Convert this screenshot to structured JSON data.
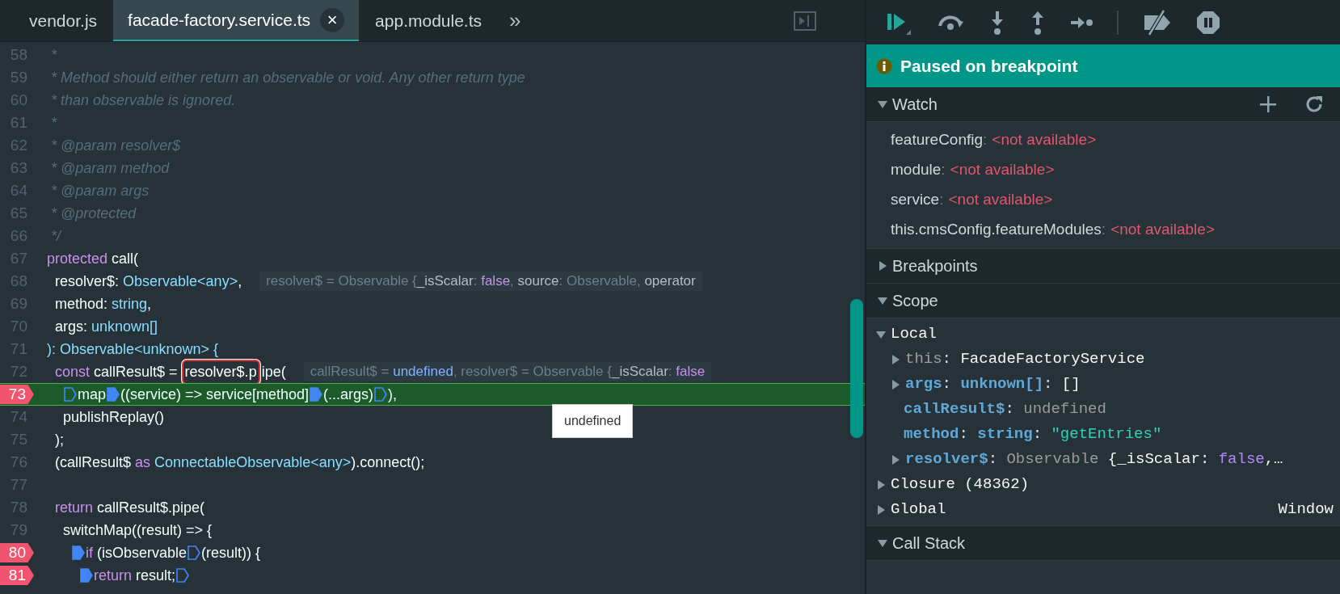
{
  "tabs": [
    {
      "label": "vendor.js",
      "selected": false
    },
    {
      "label": "facade-factory.service.ts",
      "selected": true,
      "close": "×"
    },
    {
      "label": "app.module.ts",
      "selected": false
    }
  ],
  "tabs_overflow": "»",
  "editor": {
    "lines": [
      {
        "number": "58",
        "breakpoint": false,
        "current": false,
        "tokens": [
          {
            "text": " *",
            "kind": "comment"
          }
        ]
      },
      {
        "number": "59",
        "breakpoint": false,
        "current": false,
        "tokens": [
          {
            "text": " * Method should either return an observable or void. Any other return type",
            "kind": "comment"
          }
        ]
      },
      {
        "number": "60",
        "breakpoint": false,
        "current": false,
        "tokens": [
          {
            "text": " * than observable is ignored.",
            "kind": "comment"
          }
        ]
      },
      {
        "number": "61",
        "breakpoint": false,
        "current": false,
        "tokens": [
          {
            "text": " *",
            "kind": "comment"
          }
        ]
      },
      {
        "number": "62",
        "breakpoint": false,
        "current": false,
        "tokens": [
          {
            "text": " * @param resolver$",
            "kind": "comment"
          }
        ]
      },
      {
        "number": "63",
        "breakpoint": false,
        "current": false,
        "tokens": [
          {
            "text": " * @param method",
            "kind": "comment"
          }
        ]
      },
      {
        "number": "64",
        "breakpoint": false,
        "current": false,
        "tokens": [
          {
            "text": " * @param args",
            "kind": "comment"
          }
        ]
      },
      {
        "number": "65",
        "breakpoint": false,
        "current": false,
        "tokens": [
          {
            "text": " * @protected",
            "kind": "comment"
          }
        ]
      },
      {
        "number": "66",
        "breakpoint": false,
        "current": false,
        "tokens": [
          {
            "text": " */",
            "kind": "comment"
          }
        ]
      },
      {
        "number": "67",
        "breakpoint": false,
        "current": false,
        "tokens": [
          {
            "text": "protected",
            "kind": "keyword"
          },
          {
            "text": " call(",
            "kind": "plain"
          }
        ],
        "children": [
          {
            "number": "68",
            "breakpoint": false,
            "current": false,
            "tokens": [
              {
                "text": "resolver$: ",
                "kind": "plain"
              },
              {
                "text": "Observable<any>",
                "kind": "type"
              },
              {
                "text": ",",
                "kind": "plain"
              }
            ],
            "hint": [
              {
                "text": "resolver$ = Observable {",
                "kind": "dim"
              },
              {
                "text": "_isScalar",
                "kind": "key"
              },
              {
                "text": ": ",
                "kind": "dim"
              },
              {
                "text": "false",
                "kind": "bool"
              },
              {
                "text": ", ",
                "kind": "dim"
              },
              {
                "text": "source",
                "kind": "key"
              },
              {
                "text": ": Observable, ",
                "kind": "dim"
              },
              {
                "text": "operator",
                "kind": "key"
              }
            ]
          },
          {
            "number": "69",
            "breakpoint": false,
            "current": false,
            "tokens": [
              {
                "text": "method: ",
                "kind": "plain"
              },
              {
                "text": "string",
                "kind": "type"
              },
              {
                "text": ",",
                "kind": "plain"
              }
            ]
          },
          {
            "number": "70",
            "breakpoint": false,
            "current": false,
            "tokens": [
              {
                "text": "args: ",
                "kind": "plain"
              },
              {
                "text": "unknown[]",
                "kind": "type"
              }
            ]
          }
        ]
      },
      {
        "number": "71",
        "breakpoint": false,
        "current": false,
        "tokens": [
          {
            "text": "): Observable<unknown> {",
            "kind": "type"
          }
        ],
        "children": [
          {
            "number": "72",
            "breakpoint": false,
            "current": false,
            "tokens": [
              {
                "text": "const",
                "kind": "keyword"
              },
              {
                "text": " callResult$ = ",
                "kind": "plain"
              },
              {
                "text": "resolver$.p",
                "kind": "hovered"
              },
              {
                "text": "ipe(",
                "kind": "plain"
              }
            ],
            "hint": [
              {
                "text": "callResult$ = ",
                "kind": "dim"
              },
              {
                "text": "undefined",
                "kind": "undef"
              },
              {
                "text": ", resolver$ = Observable {",
                "kind": "dim"
              },
              {
                "text": "_isScalar",
                "kind": "key"
              },
              {
                "text": ": ",
                "kind": "dim"
              },
              {
                "text": "false",
                "kind": "bool"
              }
            ],
            "children": [
              {
                "number": "73",
                "breakpoint": true,
                "current": true,
                "tokens": [
                  {
                    "kind": "marker",
                    "active": false
                  },
                  {
                    "text": "map",
                    "kind": "plain"
                  },
                  {
                    "kind": "marker",
                    "active": true
                  },
                  {
                    "text": "((service) => service[method]",
                    "kind": "plain"
                  },
                  {
                    "kind": "marker",
                    "active": true
                  },
                  {
                    "text": "(...args)",
                    "kind": "plain"
                  },
                  {
                    "kind": "marker",
                    "active": false
                  },
                  {
                    "text": "),",
                    "kind": "plain"
                  }
                ]
              },
              {
                "number": "74",
                "breakpoint": false,
                "current": false,
                "tokens": [
                  {
                    "text": "publishReplay()",
                    "kind": "plain"
                  }
                ]
              }
            ]
          },
          {
            "number": "75",
            "breakpoint": false,
            "current": false,
            "tokens": [
              {
                "text": ");",
                "kind": "plain"
              }
            ]
          },
          {
            "number": "76",
            "breakpoint": false,
            "current": false,
            "tokens": [
              {
                "text": "(callResult$ ",
                "kind": "plain"
              },
              {
                "text": "as",
                "kind": "keyword"
              },
              {
                "text": " ConnectableObservable<any>",
                "kind": "type"
              },
              {
                "text": ").connect();",
                "kind": "plain"
              }
            ]
          },
          {
            "number": "77",
            "breakpoint": false,
            "current": false
          },
          {
            "number": "78",
            "breakpoint": false,
            "current": false,
            "tokens": [
              {
                "text": "return",
                "kind": "keyword"
              },
              {
                "text": " callResult$.pipe(",
                "kind": "plain"
              }
            ],
            "children": [
              {
                "number": "79",
                "breakpoint": false,
                "current": false,
                "tokens": [
                  {
                    "text": "switchMap((result) => {",
                    "kind": "plain"
                  }
                ],
                "children": [
                  {
                    "number": "80",
                    "breakpoint": true,
                    "current": false,
                    "tokens": [
                      {
                        "kind": "marker",
                        "active": true
                      },
                      {
                        "text": "if",
                        "kind": "keyword"
                      },
                      {
                        "text": " (isObservable",
                        "kind": "plain"
                      },
                      {
                        "kind": "marker",
                        "active": false
                      },
                      {
                        "text": "(result)) {",
                        "kind": "plain"
                      }
                    ],
                    "children": [
                      {
                        "number": "81",
                        "breakpoint": true,
                        "current": false,
                        "tokens": [
                          {
                            "kind": "marker",
                            "active": true
                          },
                          {
                            "text": "return",
                            "kind": "keyword"
                          },
                          {
                            "text": " result;",
                            "kind": "plain"
                          },
                          {
                            "kind": "marker",
                            "active": false
                          }
                        ]
                      }
                    ]
                  }
                ]
              }
            ]
          }
        ]
      }
    ],
    "tooltip": "undefined"
  },
  "banner": "Paused on breakpoint",
  "watch": {
    "title": "Watch",
    "expanded": true,
    "separator": ":",
    "items": [
      {
        "name": "featureConfig",
        "value": "<not available>"
      },
      {
        "name": "module",
        "value": "<not available>"
      },
      {
        "name": "service",
        "value": "<not available>"
      },
      {
        "name": "this.cmsConfig.featureModules",
        "value": "<not available>"
      }
    ]
  },
  "breakpoints": {
    "title": "Breakpoints",
    "expanded": false
  },
  "scope": {
    "title": "Scope",
    "expanded": true,
    "groups": [
      {
        "title": "Local",
        "expanded": true,
        "entries": [
          {
            "expanded": false,
            "parts": [
              {
                "text": "this",
                "kind": "dimname"
              },
              {
                "text": ": ",
                "kind": "punct"
              },
              {
                "text": "FacadeFactoryService",
                "kind": "value"
              }
            ]
          },
          {
            "expanded": false,
            "parts": [
              {
                "text": "args",
                "kind": "name"
              },
              {
                "text": ": ",
                "kind": "punct"
              },
              {
                "text": "unknown[]",
                "kind": "name"
              },
              {
                "text": ": ",
                "kind": "punct"
              },
              {
                "text": "[]",
                "kind": "value"
              }
            ]
          },
          {
            "parts": [
              {
                "text": "callResult$",
                "kind": "name"
              },
              {
                "text": ": ",
                "kind": "punct"
              },
              {
                "text": "undefined",
                "kind": "undef"
              }
            ]
          },
          {
            "parts": [
              {
                "text": "method",
                "kind": "name"
              },
              {
                "text": ": ",
                "kind": "punct"
              },
              {
                "text": "string",
                "kind": "name"
              },
              {
                "text": ": ",
                "kind": "punct"
              },
              {
                "text": "\"getEntries\"",
                "kind": "string"
              }
            ]
          },
          {
            "expanded": false,
            "parts": [
              {
                "text": "resolver$",
                "kind": "name"
              },
              {
                "text": ": ",
                "kind": "punct"
              },
              {
                "text": "Observable ",
                "kind": "undef"
              },
              {
                "text": "{_isScalar: ",
                "kind": "value"
              },
              {
                "text": "false",
                "kind": "bool"
              },
              {
                "text": ",…",
                "kind": "value"
              }
            ]
          }
        ]
      },
      {
        "title": "Closure (48362)",
        "expanded": false
      },
      {
        "title": "Global",
        "expanded": false,
        "value": "Window"
      }
    ]
  },
  "call_stack": {
    "title": "Call Stack",
    "expanded": true
  }
}
